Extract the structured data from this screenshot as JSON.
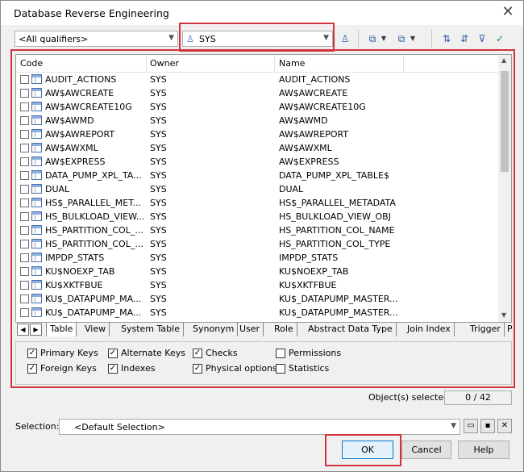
{
  "window": {
    "title": "Database Reverse Engineering",
    "close": "✕"
  },
  "toolbar": {
    "qualifier": "<All qualifiers>",
    "owner": "SYS"
  },
  "grid": {
    "columns": [
      "Code",
      "Owner",
      "Name"
    ],
    "rows": [
      {
        "code": "AUDIT_ACTIONS",
        "owner": "SYS",
        "name": "AUDIT_ACTIONS"
      },
      {
        "code": "AW$AWCREATE",
        "owner": "SYS",
        "name": "AW$AWCREATE"
      },
      {
        "code": "AW$AWCREATE10G",
        "owner": "SYS",
        "name": "AW$AWCREATE10G"
      },
      {
        "code": "AW$AWMD",
        "owner": "SYS",
        "name": "AW$AWMD"
      },
      {
        "code": "AW$AWREPORT",
        "owner": "SYS",
        "name": "AW$AWREPORT"
      },
      {
        "code": "AW$AWXML",
        "owner": "SYS",
        "name": "AW$AWXML"
      },
      {
        "code": "AW$EXPRESS",
        "owner": "SYS",
        "name": "AW$EXPRESS"
      },
      {
        "code": "DATA_PUMP_XPL_TA...",
        "owner": "SYS",
        "name": "DATA_PUMP_XPL_TABLE$"
      },
      {
        "code": "DUAL",
        "owner": "SYS",
        "name": "DUAL"
      },
      {
        "code": "HS$_PARALLEL_MET...",
        "owner": "SYS",
        "name": "HS$_PARALLEL_METADATA"
      },
      {
        "code": "HS_BULKLOAD_VIEW...",
        "owner": "SYS",
        "name": "HS_BULKLOAD_VIEW_OBJ"
      },
      {
        "code": "HS_PARTITION_COL_...",
        "owner": "SYS",
        "name": "HS_PARTITION_COL_NAME"
      },
      {
        "code": "HS_PARTITION_COL_...",
        "owner": "SYS",
        "name": "HS_PARTITION_COL_TYPE"
      },
      {
        "code": "IMPDP_STATS",
        "owner": "SYS",
        "name": "IMPDP_STATS"
      },
      {
        "code": "KU$NOEXP_TAB",
        "owner": "SYS",
        "name": "KU$NOEXP_TAB"
      },
      {
        "code": "KU$XKTFBUE",
        "owner": "SYS",
        "name": "KU$XKTFBUE"
      },
      {
        "code": "KU$_DATAPUMP_MA...",
        "owner": "SYS",
        "name": "KU$_DATAPUMP_MASTER..."
      },
      {
        "code": "KU$_DATAPUMP_MA...",
        "owner": "SYS",
        "name": "KU$_DATAPUMP_MASTER..."
      }
    ]
  },
  "tabs": [
    "Table",
    "View",
    "System Table",
    "Synonym",
    "User",
    "Role",
    "Abstract Data Type",
    "Join Index",
    "Trigger",
    "Pr"
  ],
  "options": [
    {
      "label": "Primary Keys",
      "checked": true
    },
    {
      "label": "Alternate Keys",
      "checked": true
    },
    {
      "label": "Checks",
      "checked": true
    },
    {
      "label": "Permissions",
      "checked": false
    },
    {
      "label": "Foreign Keys",
      "checked": true
    },
    {
      "label": "Indexes",
      "checked": true
    },
    {
      "label": "Physical options",
      "checked": true
    },
    {
      "label": "Statistics",
      "checked": false
    }
  ],
  "status": {
    "selected_label": "Object(s) selected:",
    "selected_count": "0 / 42"
  },
  "selection": {
    "label": "Selection:",
    "value": "<Default Selection>"
  },
  "buttons": {
    "ok": "OK",
    "cancel": "Cancel",
    "help": "Help"
  }
}
